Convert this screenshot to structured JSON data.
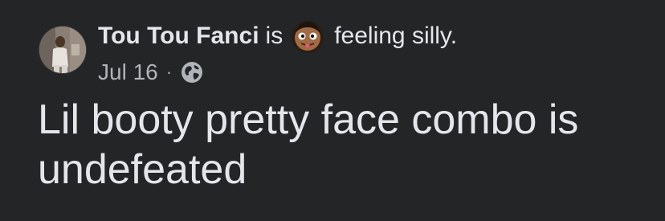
{
  "post": {
    "author": "Tou Tou Fanci",
    "is_word": "is",
    "feeling_emoji": "silly-face-emoji",
    "feeling_text": "feeling silly.",
    "date": "Jul 16",
    "separator": "·",
    "audience_icon": "globe-icon",
    "body_text": "Lil booty pretty face combo is undefeated"
  },
  "colors": {
    "background": "#242527",
    "primary_text": "#e4e6eb",
    "secondary_text": "#b0b3b8"
  }
}
